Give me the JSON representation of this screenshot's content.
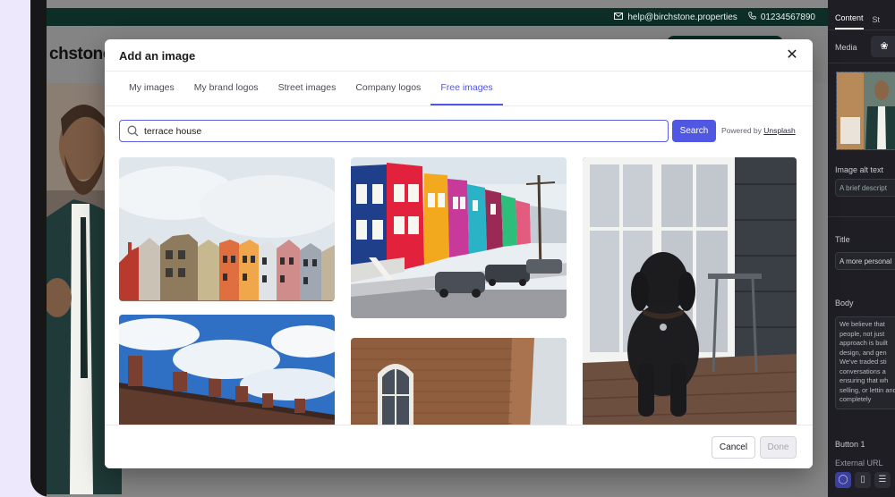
{
  "site": {
    "email": "help@birchstone.properties",
    "phone": "01234567890",
    "logo_text": "chstone"
  },
  "right_panel": {
    "tabs": [
      {
        "label": "Content"
      },
      {
        "label": "St"
      }
    ],
    "media_label": "Media",
    "alt_text_label": "Image alt text",
    "alt_text_placeholder": "A brief descript",
    "title_label": "Title",
    "title_value": "A more personal",
    "body_label": "Body",
    "body_text": "We believe that people, not just approach is built design, and gen We've traded sti conversations a ensuring that wh selling, or lettin and completely",
    "button_label": "Button 1",
    "external_url_label": "External URL"
  },
  "modal": {
    "title": "Add an image",
    "tabs": [
      {
        "label": "My images"
      },
      {
        "label": "My brand logos"
      },
      {
        "label": "Street images"
      },
      {
        "label": "Company logos"
      },
      {
        "label": "Free images"
      }
    ],
    "active_tab": 4,
    "search": {
      "value": "terrace house",
      "button_label": "Search",
      "powered_by_prefix": "Powered by",
      "powered_by_link": "Unsplash"
    },
    "results": [
      {
        "name": "result-image-colorful-rooftops"
      },
      {
        "name": "result-image-painted-rowhouses"
      },
      {
        "name": "result-image-poodle-on-porch"
      },
      {
        "name": "result-image-chimneys-blue-sky"
      },
      {
        "name": "result-image-brick-building-window"
      }
    ],
    "footer": {
      "cancel_label": "Cancel",
      "done_label": "Done"
    }
  },
  "colors": {
    "accent": "#5057e3",
    "topbar": "#0c2e27"
  }
}
